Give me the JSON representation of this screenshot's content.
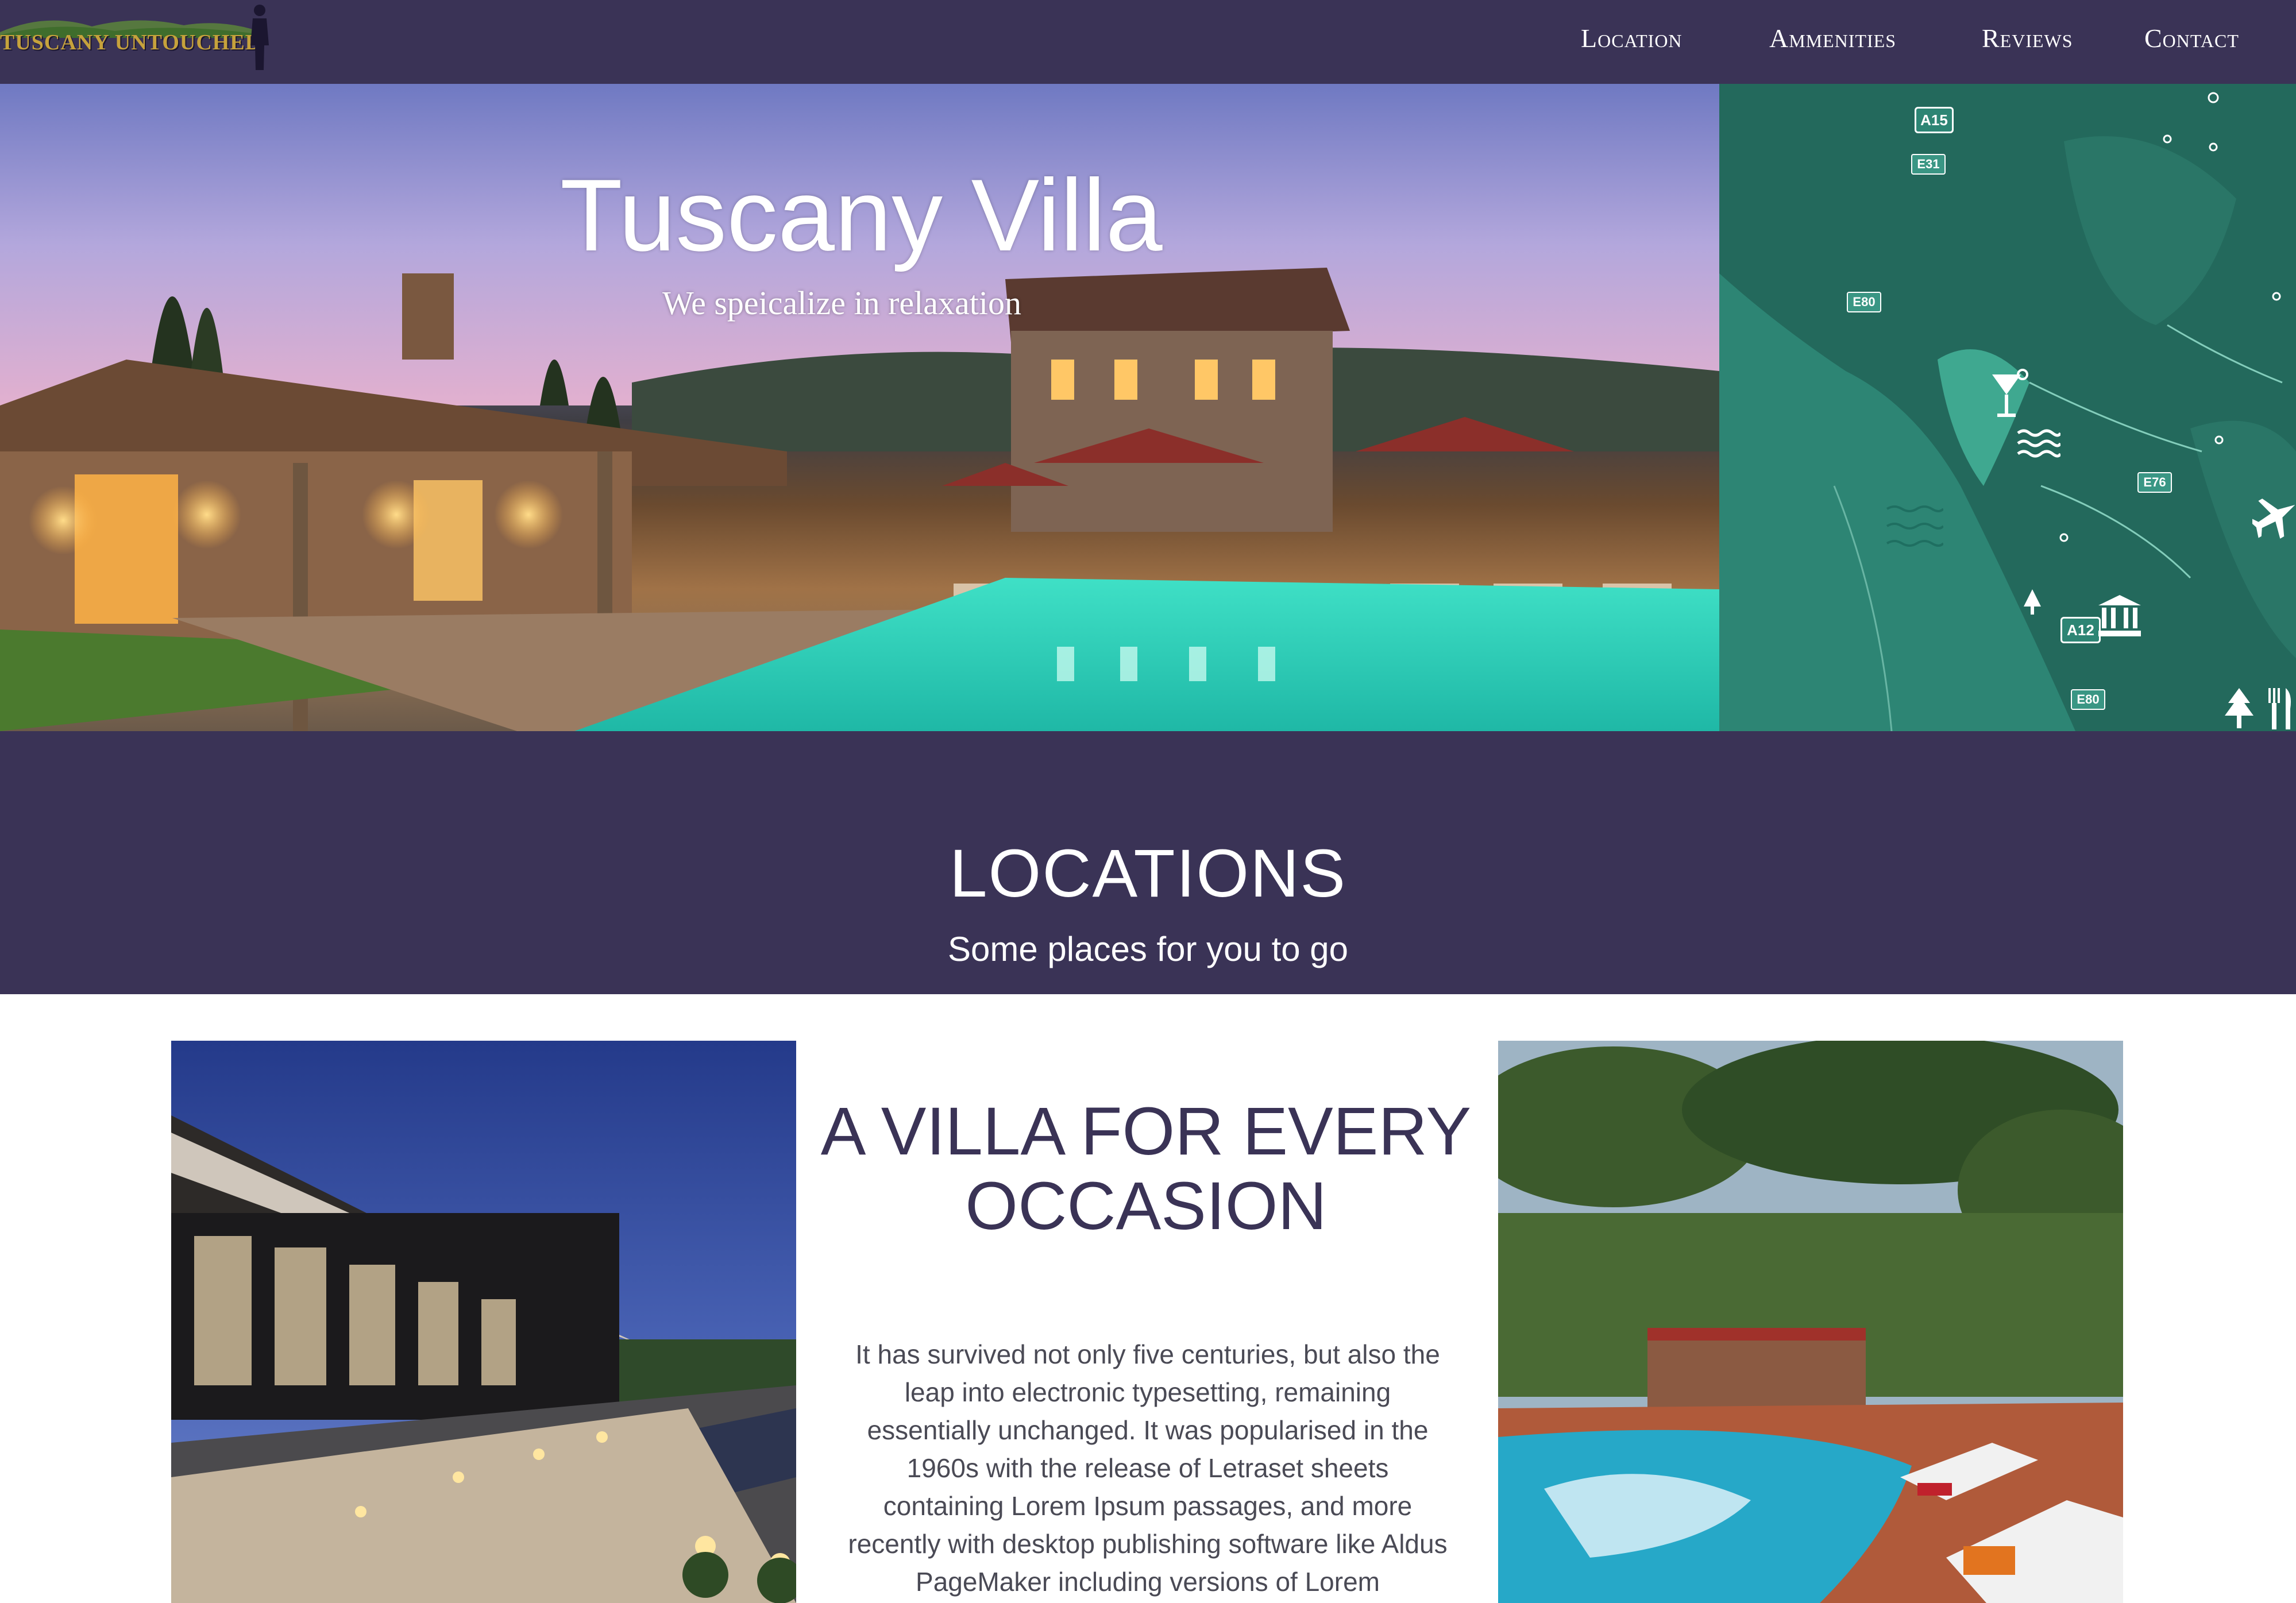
{
  "header": {
    "logo_text": "TUSCANY UNTOUCHED",
    "nav": [
      {
        "label": "Location"
      },
      {
        "label": "Ammenities"
      },
      {
        "label": "Reviews"
      },
      {
        "label": "Contact"
      }
    ]
  },
  "hero": {
    "title": "Tuscany Villa",
    "subtitle": "We speicalize in relaxation"
  },
  "map": {
    "road_labels": [
      "A15",
      "E31",
      "E80",
      "E76",
      "A12",
      "E80"
    ],
    "icons": [
      "cocktail-icon",
      "waves-icon",
      "airplane-icon",
      "museum-icon",
      "tree-icon",
      "restaurant-icon"
    ]
  },
  "locations": {
    "title": "LOCATIONS",
    "subtitle": "Some places for you to go"
  },
  "feature": {
    "title": "A VILLA FOR EVERY OCCASION",
    "body": "It has survived not only five centuries, but also the leap into electronic typesetting, remaining essentially unchanged. It was popularised in the 1960s with the release of Letraset sheets containing Lorem Ipsum passages, and more recently with desktop publishing software like Aldus PageMaker including versions of Lorem"
  },
  "colors": {
    "header_bg": "#3a3356",
    "map_bg": "#2c7f70",
    "accent_gold": "#c6a23c"
  }
}
